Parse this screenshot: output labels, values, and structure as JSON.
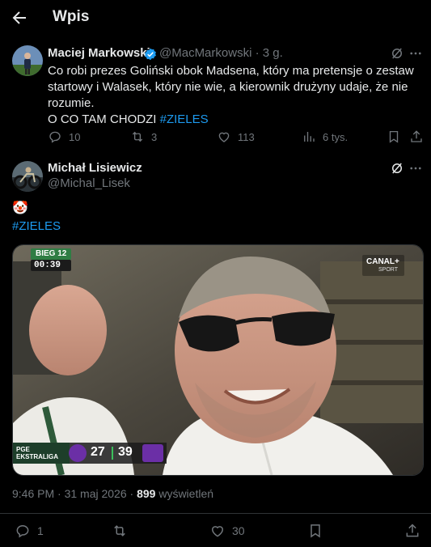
{
  "header": {
    "title": "Wpis"
  },
  "quoted_post": {
    "author_name": "Maciej Markowski",
    "handle": "@MacMarkowski",
    "time": "· 3 g.",
    "text_lines": [
      "Co robi prezes Goliński obok Madsena, który ma pretensje o zestaw",
      "startowy i Walasek, który nie wie, a kierownik drużyny udaje, że nie",
      "rozumie."
    ],
    "text_caps": "O CO TAM CHODZI ",
    "hashtag": "#ZIELES",
    "stats": {
      "replies": "10",
      "reposts": "3",
      "likes": "113",
      "views": "6 tys."
    }
  },
  "main_post": {
    "author_name": "Michał Lisiewicz",
    "handle": "@Michal_Lisek",
    "emoji": "🤡",
    "hashtag": "#ZIELES",
    "media": {
      "heat_label": "BIEG 12",
      "timer": "00:39",
      "broadcaster": "CANAL+",
      "broadcaster_sub": "SPORT",
      "league_line1": "PGE",
      "league_line2": "EKSTRALIGA",
      "score_home": "27",
      "score_away": "39"
    },
    "timestamp": "9:46 PM · 31 maj 2026 · ",
    "views_count": "899",
    "views_label": " wyświetleń",
    "stats": {
      "replies": "1",
      "likes": "30"
    }
  },
  "colors": {
    "accent": "#1d9bf0",
    "muted": "#71767b",
    "text": "#e7e9ea",
    "verified": "#1d9bf0"
  }
}
